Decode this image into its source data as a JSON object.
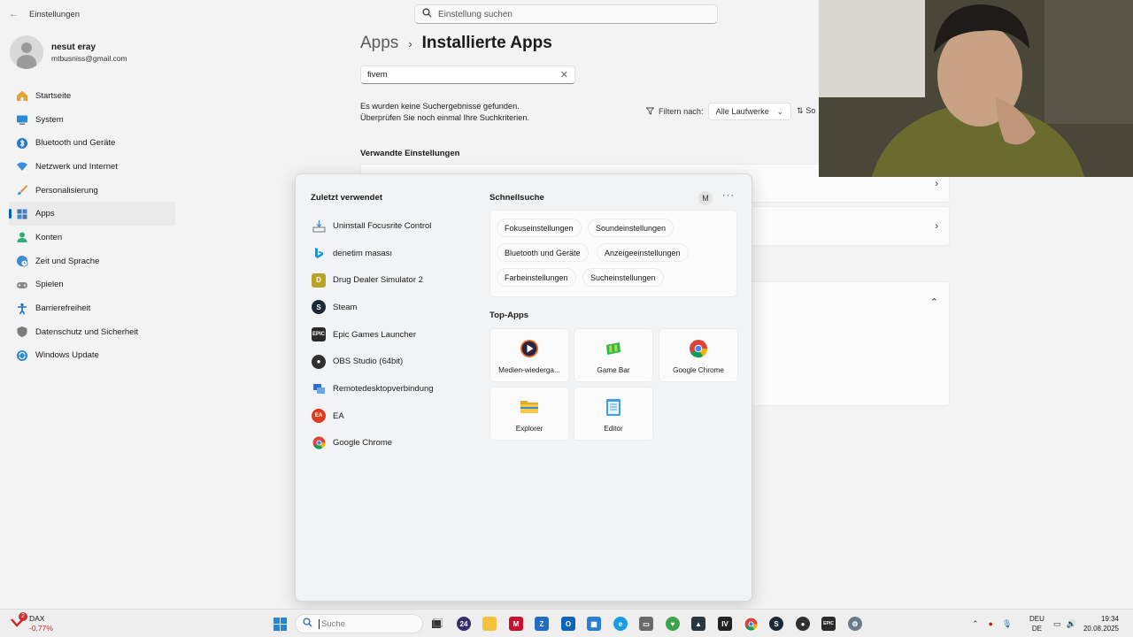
{
  "window": {
    "back": "←",
    "title": "Einstellungen",
    "search_placeholder": "Einstellung suchen"
  },
  "profile": {
    "name": "nesut eray",
    "email": "mtbusniss@gmail.com"
  },
  "nav": [
    {
      "label": "Startseite",
      "icon": "home-icon"
    },
    {
      "label": "System",
      "icon": "monitor-icon"
    },
    {
      "label": "Bluetooth und Geräte",
      "icon": "bluetooth-icon"
    },
    {
      "label": "Netzwerk und Internet",
      "icon": "wifi-icon"
    },
    {
      "label": "Personalisierung",
      "icon": "brush-icon"
    },
    {
      "label": "Apps",
      "icon": "apps-icon",
      "active": true
    },
    {
      "label": "Konten",
      "icon": "person-icon"
    },
    {
      "label": "Zeit und Sprache",
      "icon": "globe-clock-icon"
    },
    {
      "label": "Spielen",
      "icon": "gamepad-icon"
    },
    {
      "label": "Barrierefreiheit",
      "icon": "accessibility-icon"
    },
    {
      "label": "Datenschutz und Sicherheit",
      "icon": "shield-icon"
    },
    {
      "label": "Windows Update",
      "icon": "update-icon"
    }
  ],
  "page": {
    "breadcrumb_parent": "Apps",
    "breadcrumb_sep": "›",
    "title": "Installierte Apps",
    "search_value": "fivem",
    "no_results_line1": "Es wurden keine Suchergebnisse gefunden.",
    "no_results_line2": "Überprüfen Sie noch einmal Ihre Suchkriterien.",
    "filter_label": "Filtern nach:",
    "filter_value": "Alle Laufwerke",
    "sort_label": "So",
    "related_heading": "Verwandte Einstellungen"
  },
  "flyout": {
    "recent_heading": "Zuletzt verwendet",
    "recent": [
      {
        "label": "Uninstall Focusrite Control",
        "icon": "uninstall-icon",
        "color": "#ffffff"
      },
      {
        "label": "denetim masası",
        "icon": "bing-icon",
        "color": "#ffffff"
      },
      {
        "label": "Drug Dealer Simulator 2",
        "icon": "game-icon",
        "color": "#b8a325"
      },
      {
        "label": "Steam",
        "icon": "steam-icon",
        "color": "#1b2838"
      },
      {
        "label": "Epic Games Launcher",
        "icon": "epic-icon",
        "color": "#2a2a2a"
      },
      {
        "label": "OBS Studio (64bit)",
        "icon": "obs-icon",
        "color": "#303030"
      },
      {
        "label": "Remotedesktopverbindung",
        "icon": "remote-desktop-icon",
        "color": "#2f6fc4"
      },
      {
        "label": "EA",
        "icon": "ea-icon",
        "color": "#e03b1d"
      },
      {
        "label": "Google Chrome",
        "icon": "chrome-icon",
        "color": "#ffffff"
      }
    ],
    "quick_heading": "Schnellsuche",
    "account_initial": "M",
    "more": "···",
    "chips": [
      "Fokuseinstellungen",
      "Soundeinstellungen",
      "Bluetooth und Geräte",
      "Anzeigeeinstellungen",
      "Farbeinstellungen",
      "Sucheinstellungen"
    ],
    "top_heading": "Top-Apps",
    "top_apps": [
      {
        "label": "Medien-wiedergа...",
        "icon": "media-player-icon"
      },
      {
        "label": "Game Bar",
        "icon": "game-bar-icon"
      },
      {
        "label": "Google Chrome",
        "icon": "chrome-icon"
      },
      {
        "label": "Explorer",
        "icon": "folder-icon"
      },
      {
        "label": "Editor",
        "icon": "notepad-icon"
      }
    ]
  },
  "taskbar": {
    "weather_badge": "2",
    "index_name": "DAX",
    "index_change": "-0,77%",
    "search_placeholder": "Suche",
    "lang_top": "DEU",
    "lang_bottom": "DE",
    "time": "19:34",
    "date": "20.08.2025"
  }
}
